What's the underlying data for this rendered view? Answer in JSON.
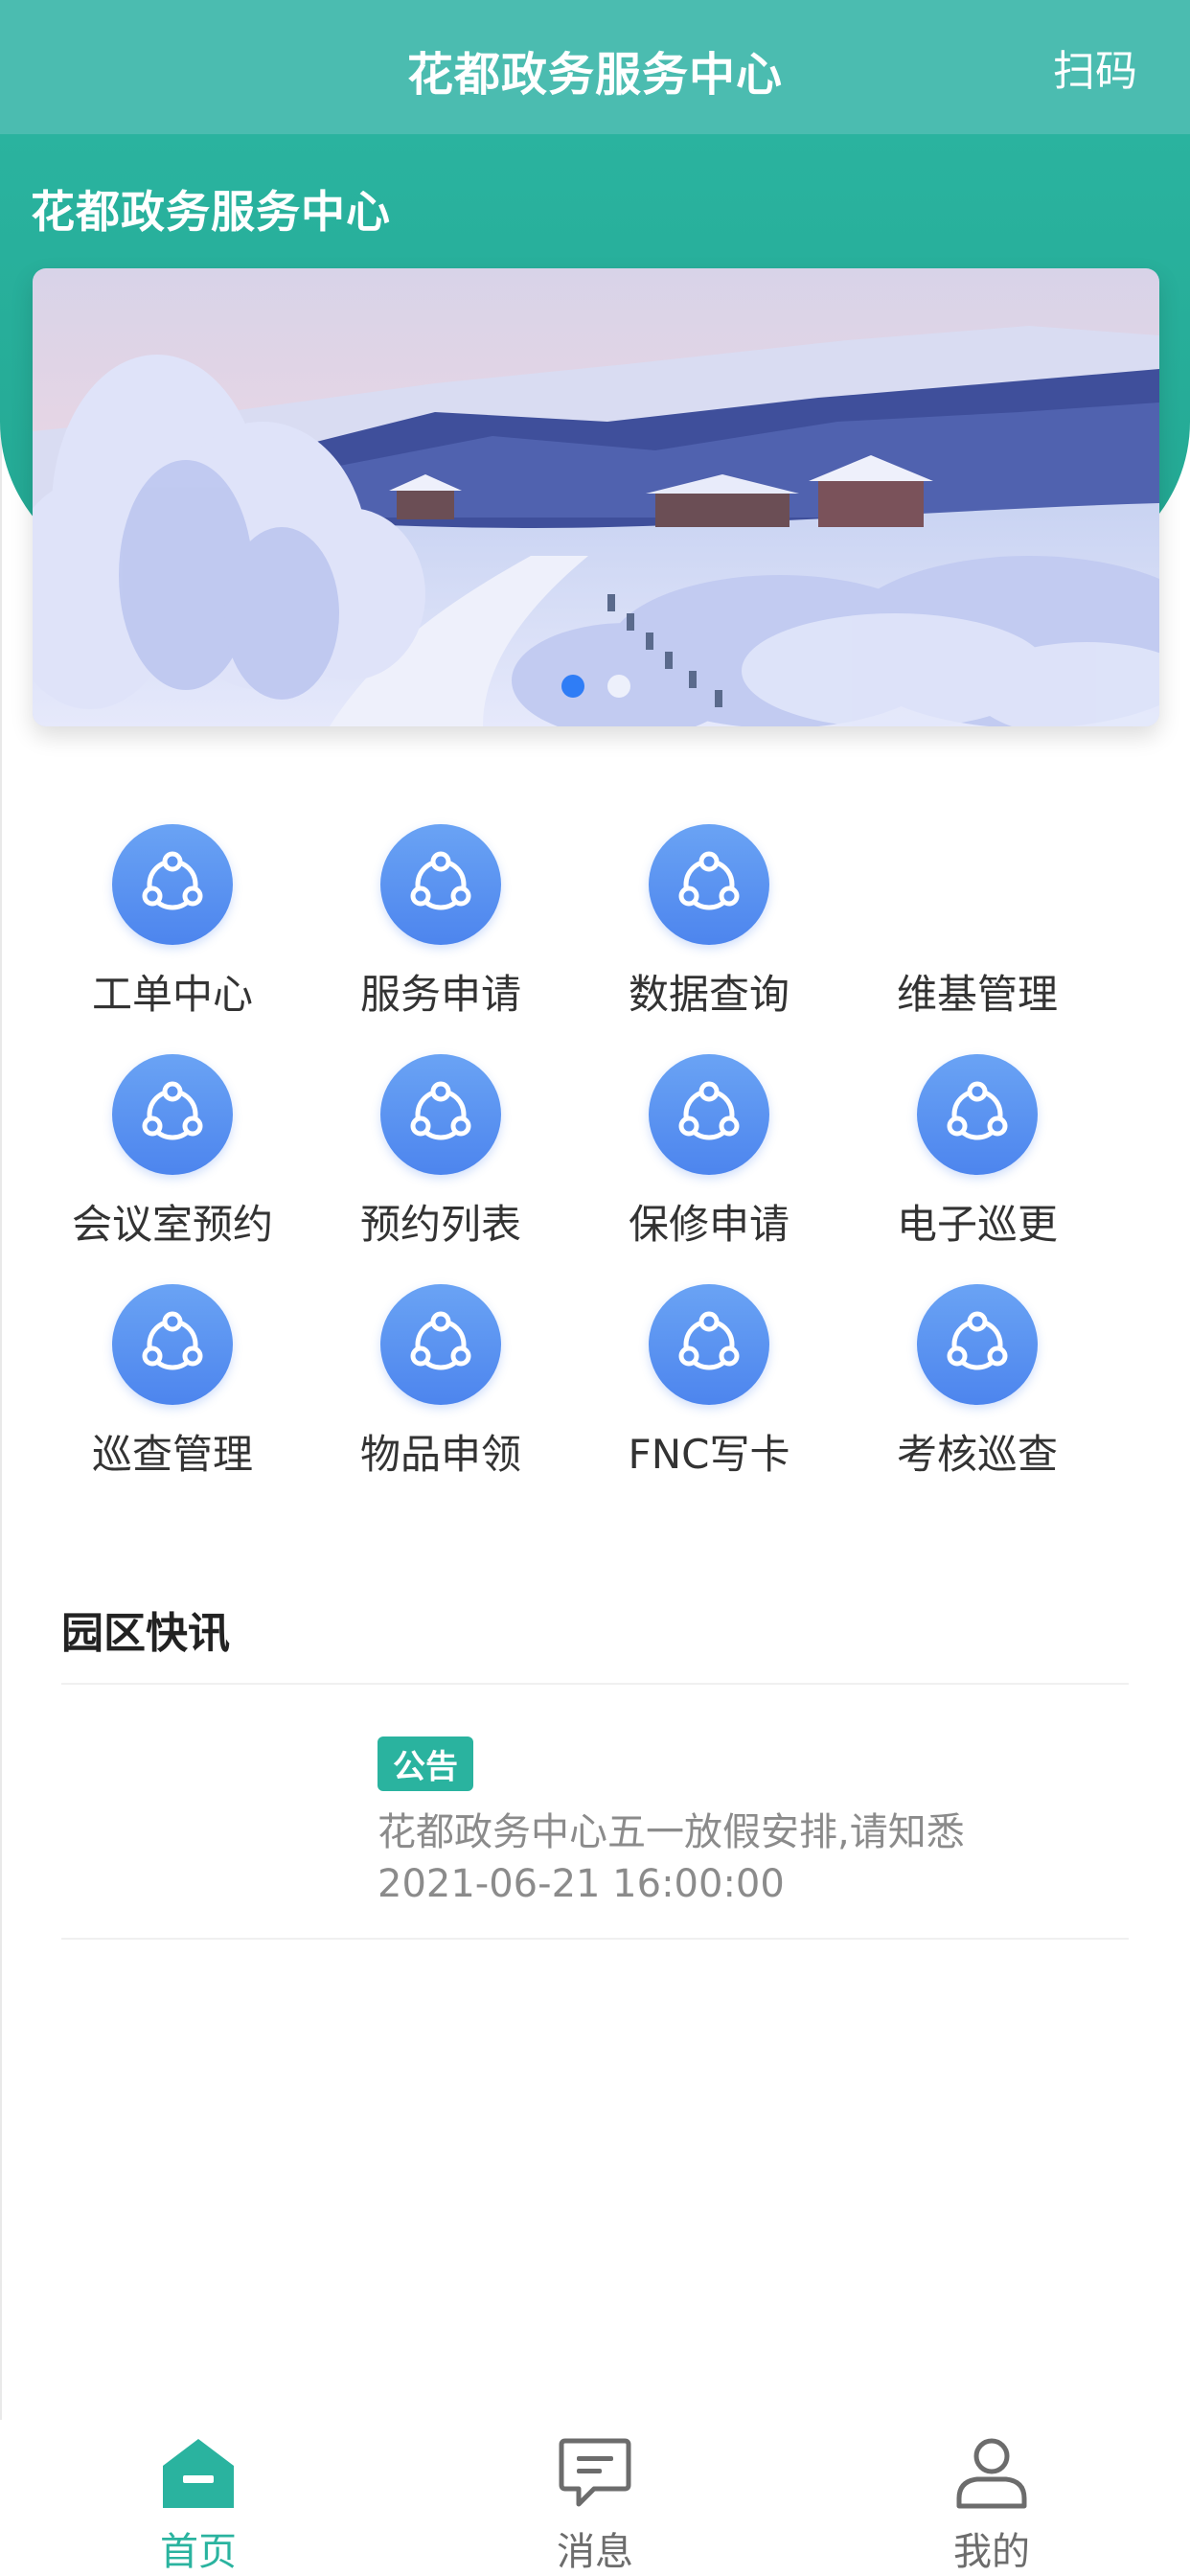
{
  "navbar": {
    "title": "花都政务服务中心",
    "scan_label": "扫码"
  },
  "header": {
    "title": "花都政务服务中心"
  },
  "banner": {
    "image": "snowy-landscape",
    "dots": 2,
    "active_dot": 1
  },
  "grid": {
    "icon": "share-icon",
    "items": [
      {
        "label": "工单中心",
        "has_icon": true
      },
      {
        "label": "服务申请",
        "has_icon": true
      },
      {
        "label": "数据查询",
        "has_icon": true
      },
      {
        "label": "维基管理",
        "has_icon": false
      },
      {
        "label": "会议室预约",
        "has_icon": true
      },
      {
        "label": "预约列表",
        "has_icon": true
      },
      {
        "label": "保修申请",
        "has_icon": true
      },
      {
        "label": "电子巡更",
        "has_icon": true
      },
      {
        "label": "巡查管理",
        "has_icon": true
      },
      {
        "label": "物品申领",
        "has_icon": true
      },
      {
        "label": "FNC写卡",
        "has_icon": true
      },
      {
        "label": "考核巡查",
        "has_icon": true
      }
    ]
  },
  "news": {
    "section_title": "园区快讯",
    "items": [
      {
        "badge": "公告",
        "text": "花都政务中心五一放假安排,请知悉",
        "date": "2021-06-21 16:00:00"
      }
    ]
  },
  "tabbar": {
    "items": [
      {
        "label": "首页",
        "icon": "home-icon",
        "active": true
      },
      {
        "label": "消息",
        "icon": "message-icon",
        "active": false
      },
      {
        "label": "我的",
        "icon": "user-icon",
        "active": false
      }
    ]
  },
  "colors": {
    "primary": "#2ab39f",
    "navbar": "#4bbcb0",
    "icon_blue": "#4d85ee",
    "dot_active": "#2f7df6"
  }
}
